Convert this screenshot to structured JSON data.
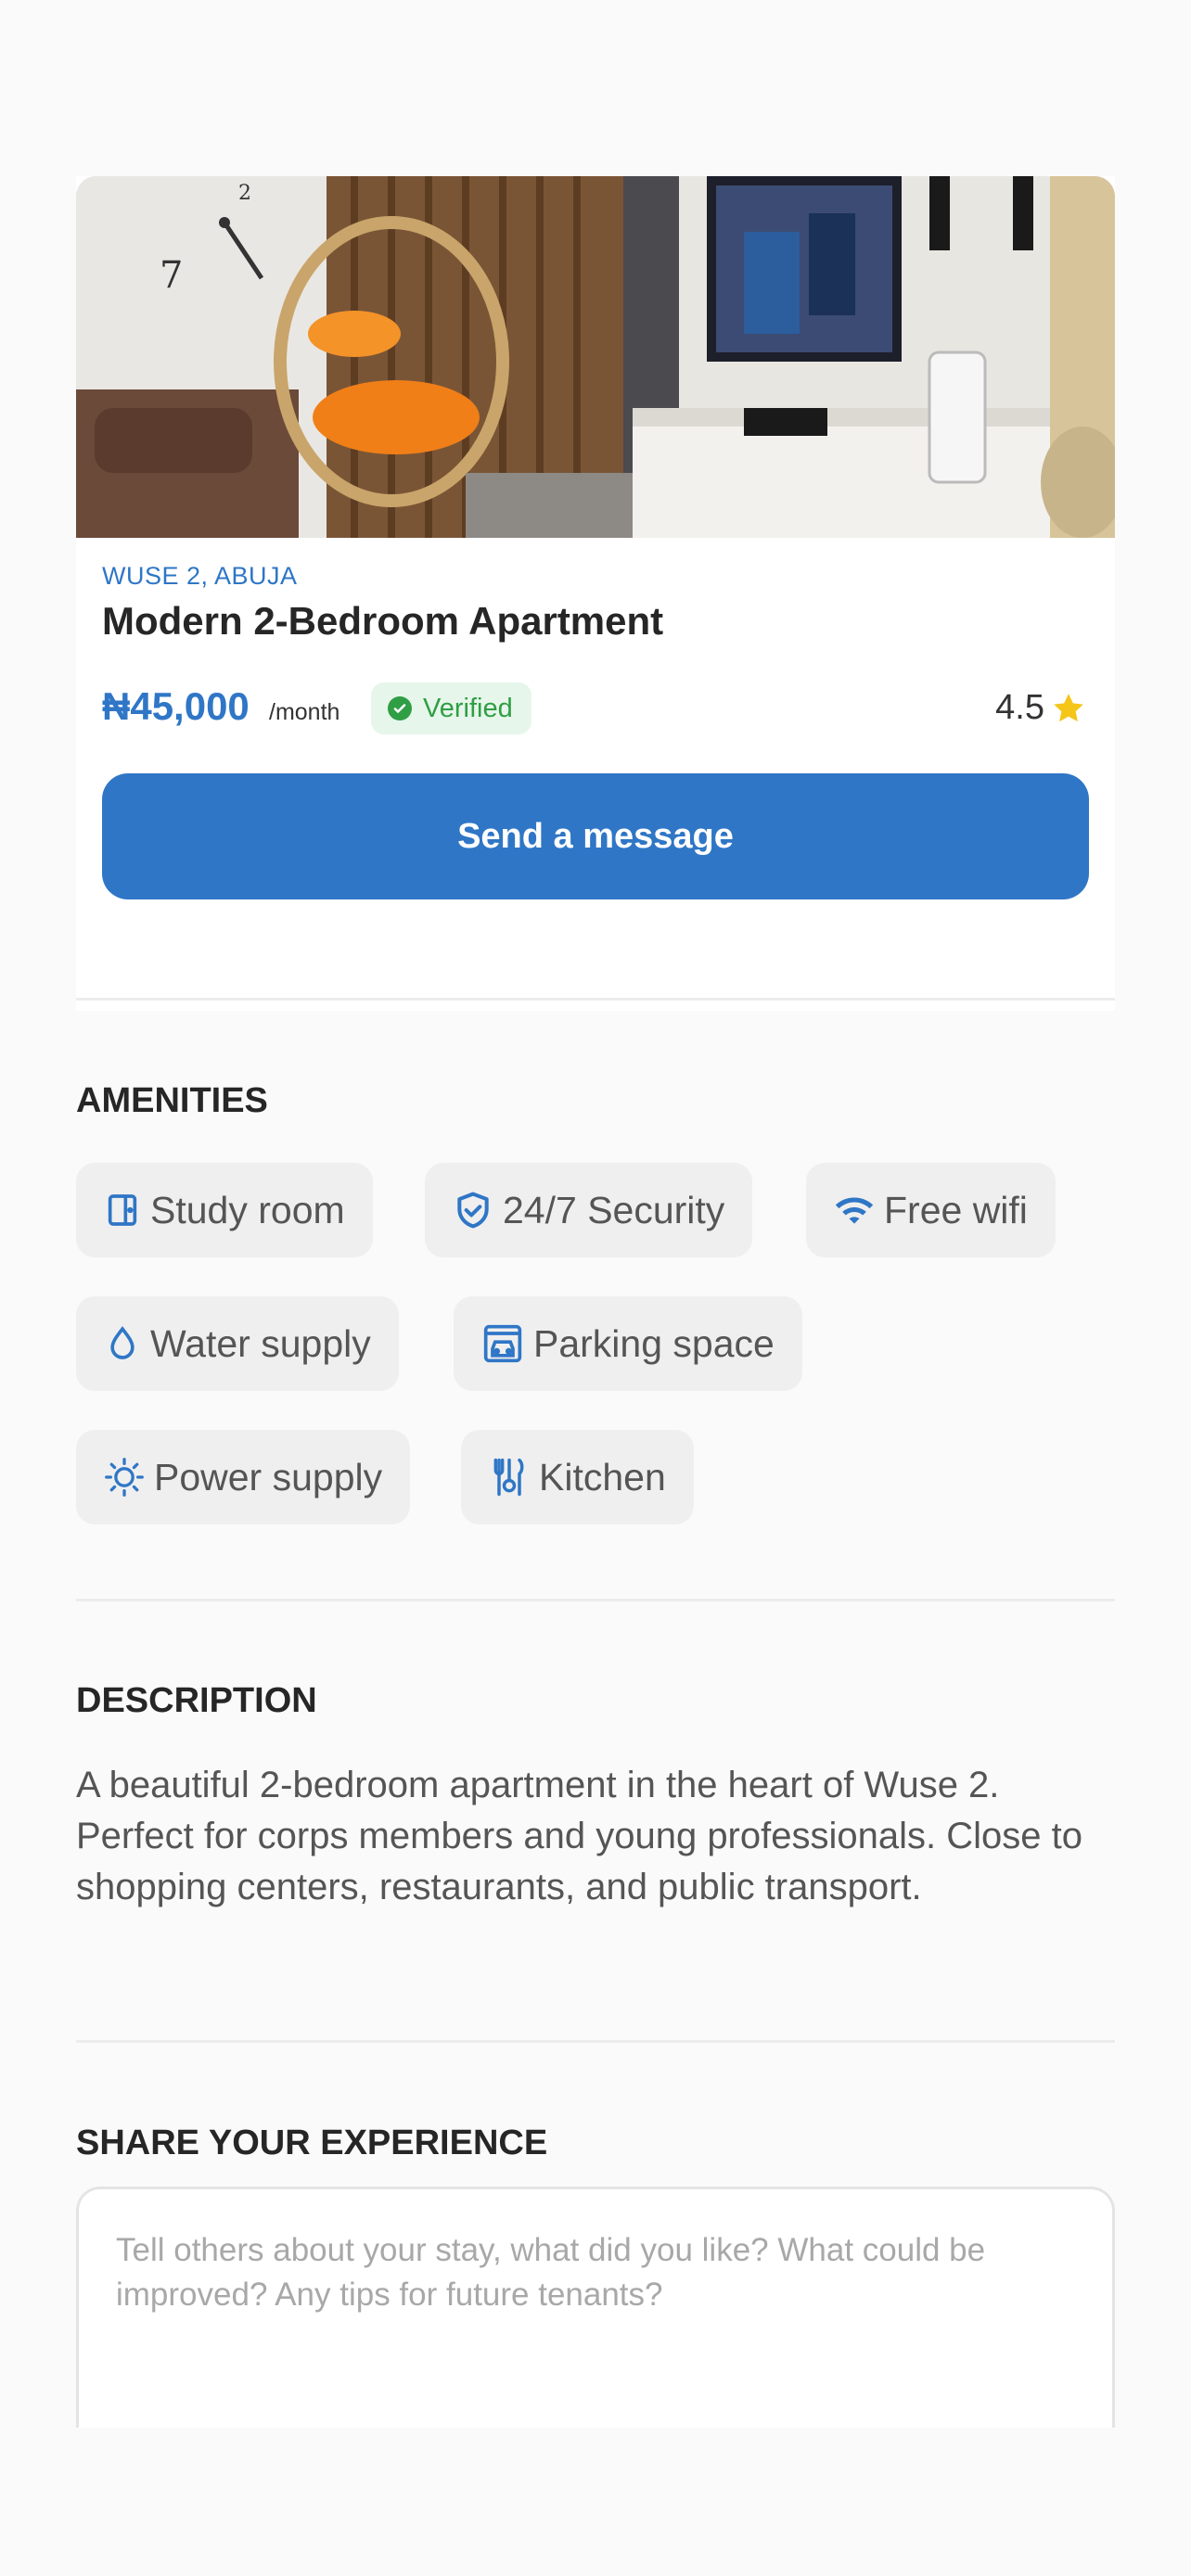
{
  "listing": {
    "location": "WUSE 2, ABUJA",
    "title": "Modern 2-Bedroom Apartment",
    "price": "₦45,000",
    "price_unit": "/month",
    "verified_label": "Verified",
    "rating": "4.5",
    "primary_action": "Send a message"
  },
  "amenities": {
    "heading": "AMENITIES",
    "items": [
      {
        "label": "Study room",
        "icon": "door-icon"
      },
      {
        "label": "24/7 Security",
        "icon": "shield-check-icon"
      },
      {
        "label": "Free wifi",
        "icon": "wifi-icon"
      },
      {
        "label": "Water supply",
        "icon": "water-drop-icon"
      },
      {
        "label": "Parking space",
        "icon": "car-garage-icon"
      },
      {
        "label": "Power supply",
        "icon": "bulb-icon"
      },
      {
        "label": "Kitchen",
        "icon": "utensils-icon"
      }
    ]
  },
  "description": {
    "heading": "DESCRIPTION",
    "text": "A beautiful 2-bedroom apartment in the heart of Wuse 2. Perfect for corps members and young professionals. Close to shopping centers, restaurants, and public transport."
  },
  "experience": {
    "heading": "SHARE YOUR EXPERIENCE",
    "placeholder": "Tell others about your stay, what did you like? What could be improved? Any tips for future tenants?",
    "value": ""
  },
  "colors": {
    "accent": "#2f76c6",
    "verified": "#2f9e44",
    "star": "#f5c518"
  }
}
